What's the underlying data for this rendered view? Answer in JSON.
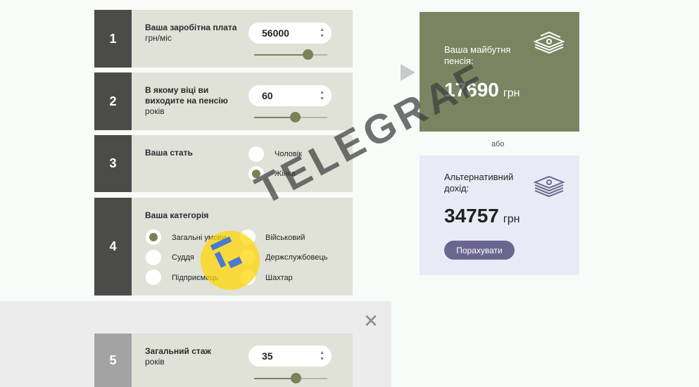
{
  "steps": [
    {
      "num": "1",
      "label": "Ваша заробітна плата",
      "unit": "грн/міс",
      "value": "56000",
      "slider_fraction": 0.73
    },
    {
      "num": "2",
      "label": "В якому віці ви виходите на пенсію",
      "unit": "років",
      "value": "60",
      "slider_fraction": 0.56
    },
    {
      "num": "3",
      "label": "Ваша стать",
      "options": [
        {
          "label": "Чоловік",
          "selected": false
        },
        {
          "label": "Жінка",
          "selected": true
        }
      ]
    },
    {
      "num": "4",
      "label": "Ваша категорія",
      "options": [
        {
          "label": "Загальні умови",
          "selected": true
        },
        {
          "label": "Військовий",
          "selected": false
        },
        {
          "label": "Суддя",
          "selected": false
        },
        {
          "label": "Держслужбовець",
          "selected": false
        },
        {
          "label": "Підприємець",
          "selected": false
        },
        {
          "label": "Шахтар",
          "selected": false
        }
      ]
    },
    {
      "num": "5",
      "label": "Загальний стаж",
      "unit": "років",
      "value": "35",
      "slider_fraction": 0.57
    }
  ],
  "result": {
    "title": "Ваша майбутня пенсія:",
    "amount": "17690",
    "currency": "грн"
  },
  "or_text": "або",
  "alternative": {
    "title": "Альтернативний дохід:",
    "amount": "34757",
    "currency": "грн",
    "button_label": "Порахувати"
  },
  "watermark": {
    "text": "TELEGRAF"
  },
  "icons": {
    "close": "close-icon",
    "money": "money-stack-icon",
    "arrow": "play-arrow-icon"
  },
  "colors": {
    "accent": "#7a8157",
    "result_bg": "#7a8460",
    "alt_bg": "#e8eaf6",
    "button": "#6b668f"
  }
}
